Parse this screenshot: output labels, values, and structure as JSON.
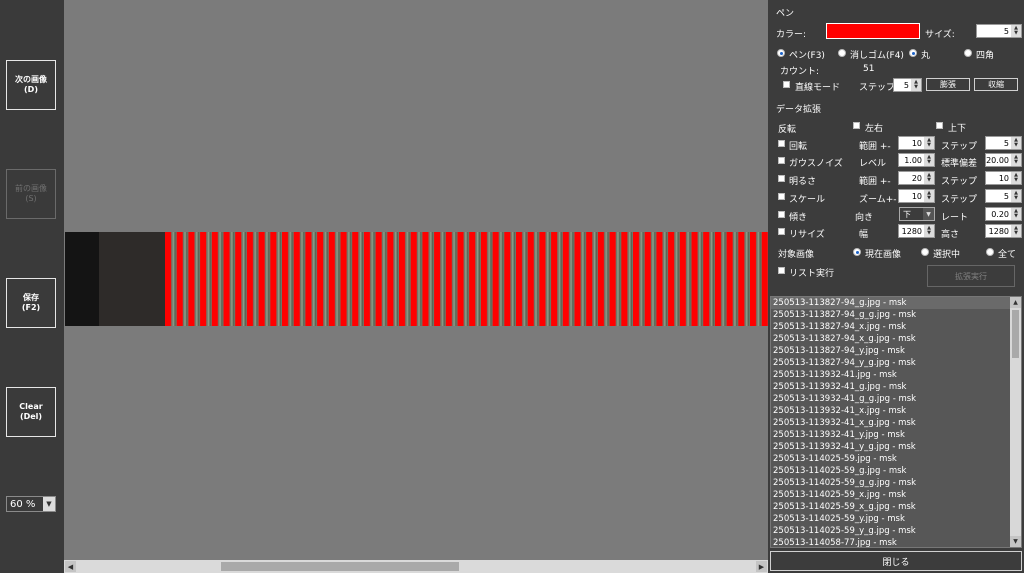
{
  "left_toolbar": {
    "next_label": "次の画像",
    "next_key": "(D)",
    "prev_label": "前の画像",
    "prev_key": "(S)",
    "save_label": "保存",
    "save_key": "(F2)",
    "clear_label": "Clear",
    "clear_key": "(Del)",
    "zoom_value": "60 %"
  },
  "pen": {
    "section_title": "ペン",
    "color_label": "カラー:",
    "color_value": "#ff0000",
    "size_label": "サイズ:",
    "size_value": "5",
    "mode_pen": "ペン(F3)",
    "mode_eraser": "消しゴム(F4)",
    "shape_round": "丸",
    "shape_square": "四角",
    "count_label": "カウント:",
    "count_value": "51",
    "line_mode_label": "直線モード",
    "step_label": "ステップ",
    "step_value": "5",
    "expand_button": "膨張",
    "shrink_button": "収縮"
  },
  "augment": {
    "section_title": "データ拡張",
    "flip_label": "反転",
    "flip_lr": "左右",
    "flip_ud": "上下",
    "rotate_label": "回転",
    "rotate_range_label": "範囲 +-",
    "rotate_range_value": "10",
    "rotate_step_label": "ステップ",
    "rotate_step_value": "5",
    "noise_label": "ガウスノイズ",
    "noise_level_label": "レベル",
    "noise_level_value": "1.00",
    "noise_std_label": "標準偏差",
    "noise_std_value": "20.00",
    "bright_label": "明るさ",
    "bright_range_label": "範囲 +-",
    "bright_range_value": "20",
    "bright_step_label": "ステップ",
    "bright_step_value": "10",
    "scale_label": "スケール",
    "scale_zoom_label": "ズーム+-",
    "scale_zoom_value": "10",
    "scale_step_label": "ステップ",
    "scale_step_value": "5",
    "tilt_label": "傾き",
    "tilt_dir_label": "向き",
    "tilt_dir_value": "下",
    "tilt_rate_label": "レート",
    "tilt_rate_value": "0.20",
    "resize_label": "リサイズ",
    "resize_width_label": "幅",
    "resize_width_value": "1280",
    "resize_height_label": "高さ",
    "resize_height_value": "1280",
    "target_label": "対象画像",
    "target_current": "現在画像",
    "target_selected": "選択中",
    "target_all": "全て",
    "list_exec_label": "リスト実行",
    "run_button": "拡張実行"
  },
  "file_list": [
    "250513-113827-94_g.jpg - msk",
    "250513-113827-94_g_g.jpg - msk",
    "250513-113827-94_x.jpg - msk",
    "250513-113827-94_x_g.jpg - msk",
    "250513-113827-94_y.jpg - msk",
    "250513-113827-94_y_g.jpg - msk",
    "250513-113932-41.jpg - msk",
    "250513-113932-41_g.jpg - msk",
    "250513-113932-41_g_g.jpg - msk",
    "250513-113932-41_x.jpg - msk",
    "250513-113932-41_x_g.jpg - msk",
    "250513-113932-41_y.jpg - msk",
    "250513-113932-41_y_g.jpg - msk",
    "250513-114025-59.jpg - msk",
    "250513-114025-59_g.jpg - msk",
    "250513-114025-59_g_g.jpg - msk",
    "250513-114025-59_x.jpg - msk",
    "250513-114025-59_x_g.jpg - msk",
    "250513-114025-59_y.jpg - msk",
    "250513-114025-59_y_g.jpg - msk",
    "250513-114058-77.jpg - msk"
  ],
  "close_button": "閉じる",
  "colors": {
    "mask_red": "#ff0000",
    "stripe_gray": "#6d7768",
    "canvas_bg": "#7b7b7b",
    "panel_bg": "#3c3c3c"
  }
}
